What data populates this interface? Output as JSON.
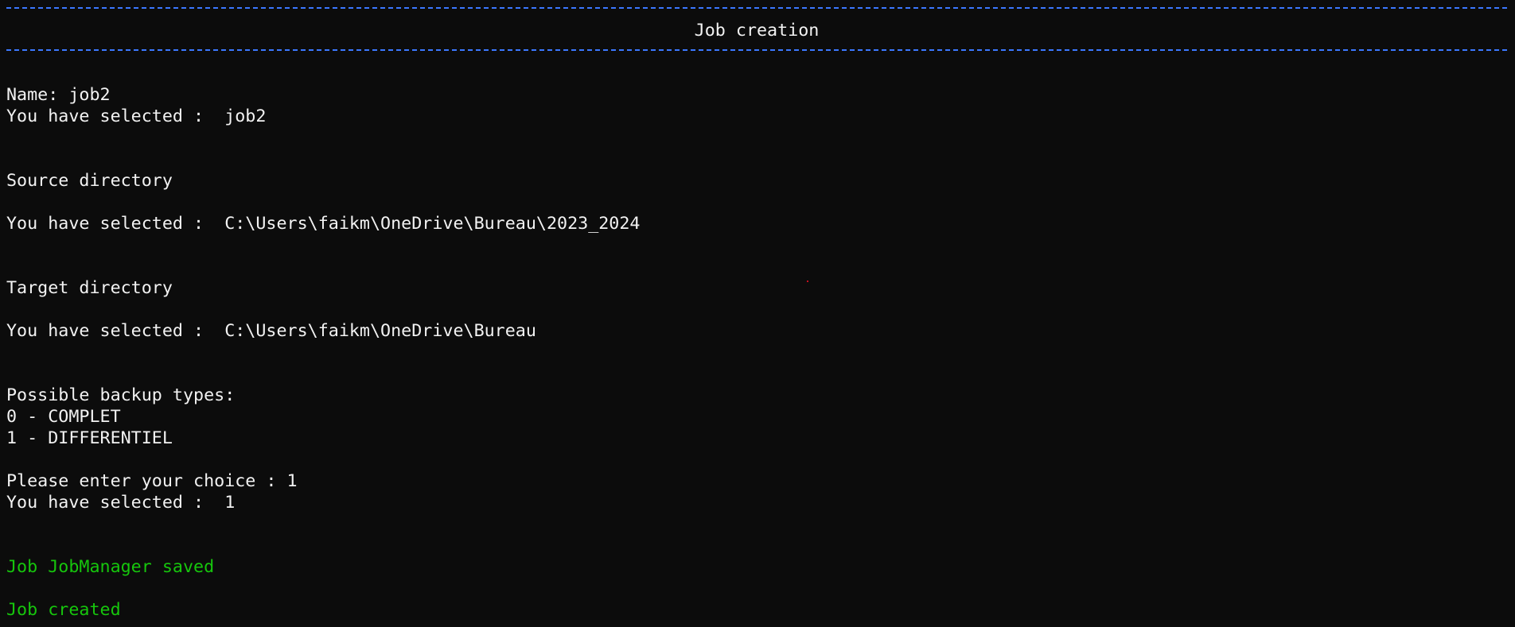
{
  "terminal": {
    "header_title": "Job creation",
    "lines": {
      "name": "Name: job2",
      "name_selected": "You have selected :  job2",
      "source_label": "Source directory",
      "source_selected": "You have selected :  C:\\Users\\faikm\\OneDrive\\Bureau\\2023_2024",
      "target_label": "Target directory",
      "target_selected": "You have selected :  C:\\Users\\faikm\\OneDrive\\Bureau",
      "backup_types_label": "Possible backup types:",
      "backup_type_0": "0 - COMPLET",
      "backup_type_1": "1 - DIFFERENTIEL",
      "choice_prompt": "Please enter your choice : 1",
      "choice_selected": "You have selected :  1",
      "saved_message": "Job JobManager saved",
      "created_message": "Job created"
    }
  },
  "colors": {
    "background": "#0c0c0c",
    "text": "#f2f2f2",
    "rule": "#3b78ff",
    "success": "#16c60c"
  }
}
